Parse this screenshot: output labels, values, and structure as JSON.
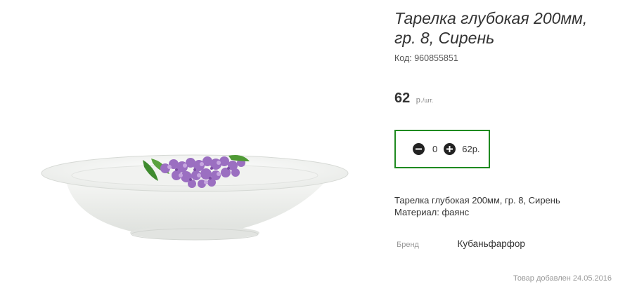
{
  "product": {
    "title_line1": "Тарелка глубокая 200мм,",
    "title_line2": "гр. 8, Сирень",
    "code_label": "Код:",
    "code_value": "960855851",
    "image_alt": "Тарелка глубокая с рисунком сирени"
  },
  "price": {
    "value": "62",
    "currency": "р.",
    "unit": "/шт."
  },
  "cart": {
    "quantity": "0",
    "total": "62р.",
    "accent_color": "#1f8a20",
    "minus_icon": "minus-circle-icon",
    "plus_icon": "plus-circle-icon"
  },
  "description": {
    "line1": "Тарелка глубокая 200мм, гр. 8, Сирень",
    "line2": "Материал: фаянс"
  },
  "brand": {
    "label": "Бренд",
    "value": "Кубаньфарфор"
  },
  "meta": {
    "added": "Товар добавлен 24.05.2016"
  }
}
